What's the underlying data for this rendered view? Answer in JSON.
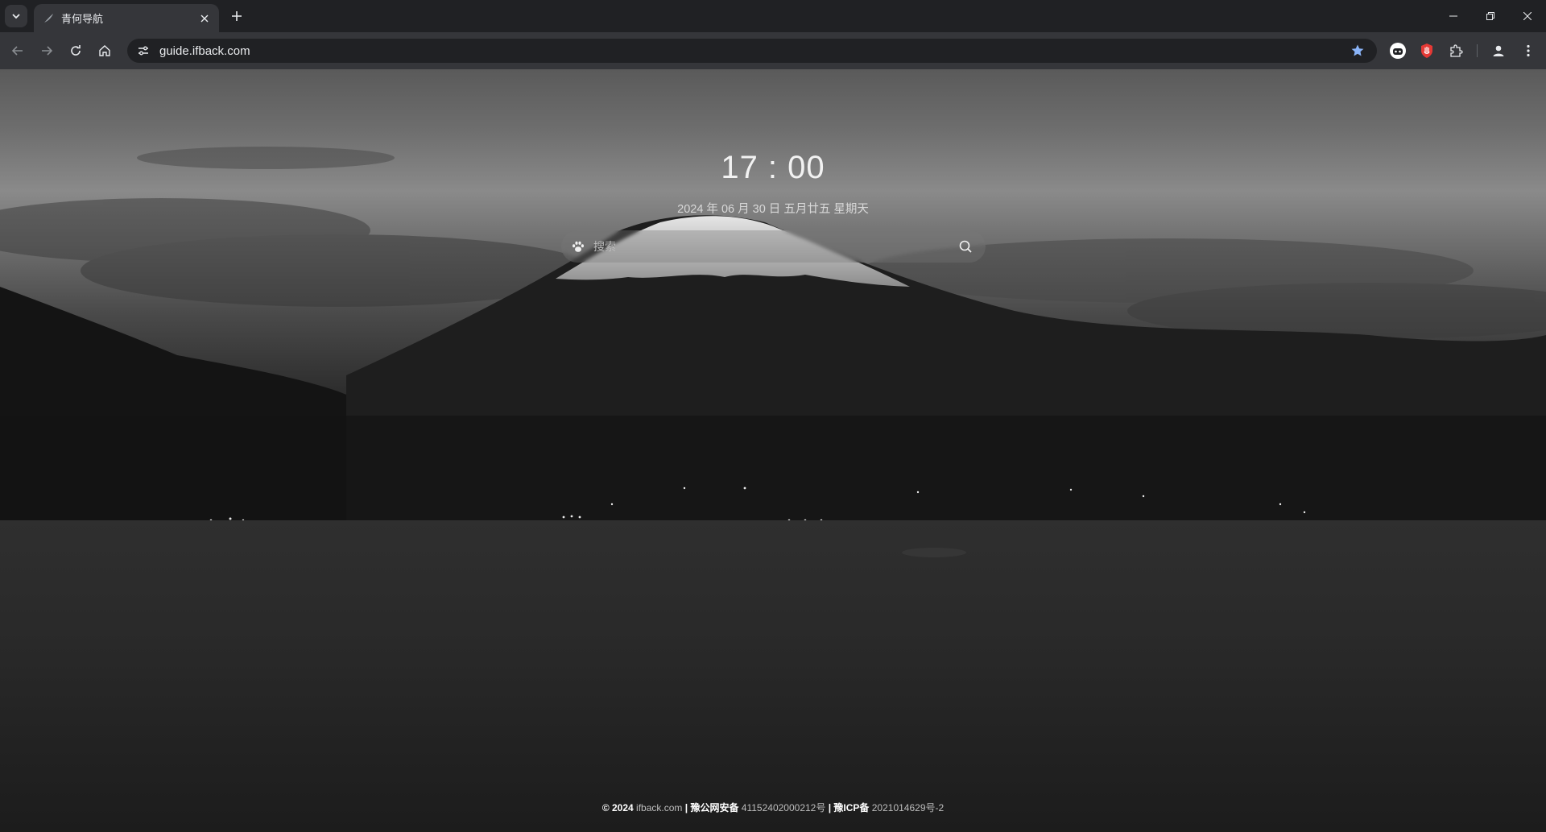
{
  "browser": {
    "tab": {
      "title": "青何导航"
    },
    "url": "guide.ifback.com"
  },
  "page": {
    "clock": "17 : 00",
    "date": "2024 年 06 月 30 日 五月廿五 星期天",
    "search": {
      "placeholder": "搜索"
    },
    "footer": {
      "copyright": "© 2024",
      "site": "ifback.com",
      "separator": "|",
      "police_label": "豫公网安备",
      "police_number": "41152402000212号",
      "icp_label": "豫ICP备",
      "icp_number": "2021014629号-2"
    }
  },
  "colors": {
    "chrome_dark": "#202124",
    "chrome_toolbar": "#35363a",
    "bookmark_star": "#8ab4f8",
    "extension_red": "#e53935"
  },
  "icons": {
    "tab_list": "chevron-down-icon",
    "favicon": "feather-icon",
    "close_tab": "close-icon",
    "new_tab": "plus-icon",
    "minimize": "minimize-icon",
    "restore": "restore-icon",
    "close_window": "close-icon",
    "back": "arrow-left-icon",
    "forward": "arrow-right-icon",
    "reload": "reload-icon",
    "home": "home-icon",
    "site_info": "tune-icon",
    "bookmark": "star-icon",
    "search_engine": "paw-icon",
    "search_submit": "search-icon"
  }
}
